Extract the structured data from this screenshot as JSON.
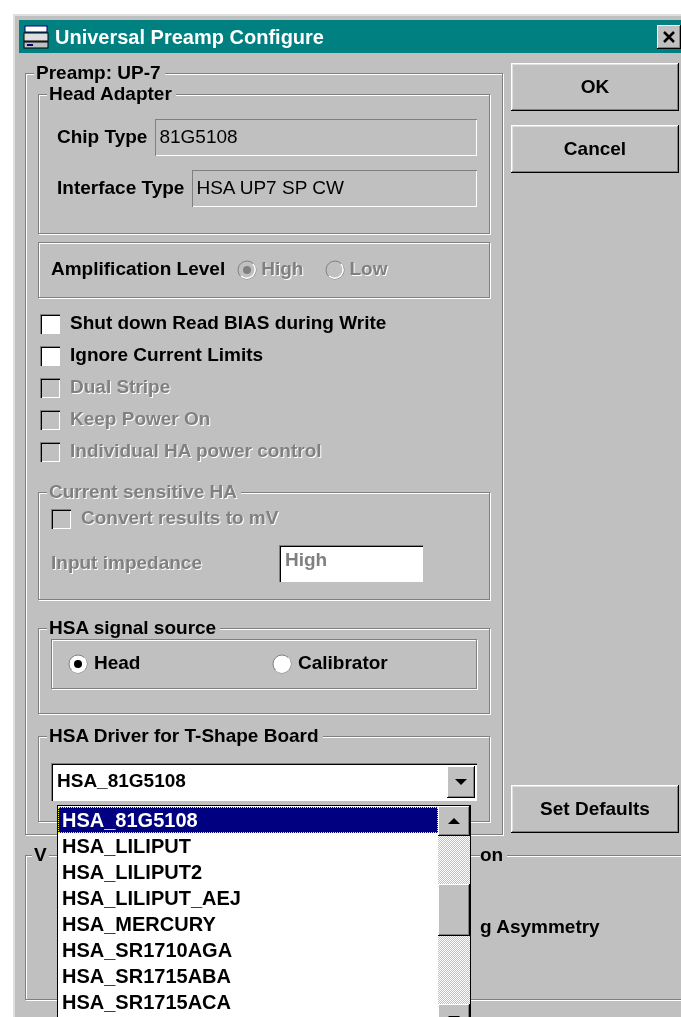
{
  "window": {
    "title": "Universal Preamp Configure"
  },
  "preamp_group": {
    "title": "Preamp: UP-7",
    "head_adapter": {
      "title": "Head Adapter",
      "fields": [
        {
          "label": "Chip Type",
          "value": "81G5108"
        },
        {
          "label": "Interface Type",
          "value": "HSA UP7 SP CW"
        }
      ]
    },
    "amplification_level": {
      "label": "Amplification Level",
      "options": [
        {
          "label": "High",
          "selected": true,
          "disabled": true
        },
        {
          "label": "Low",
          "selected": false,
          "disabled": true
        }
      ]
    },
    "checkboxes": [
      {
        "label": "Shut down Read BIAS during Write",
        "checked": false,
        "disabled": false
      },
      {
        "label": "Ignore Current Limits",
        "checked": false,
        "disabled": false
      },
      {
        "label": "Dual Stripe",
        "checked": false,
        "disabled": true
      },
      {
        "label": "Keep Power On",
        "checked": false,
        "disabled": true
      },
      {
        "label": "Individual HA power control",
        "checked": false,
        "disabled": true
      }
    ],
    "current_sensitive_ha": {
      "title": "Current sensitive HA",
      "disabled": true,
      "checkbox": {
        "label": "Convert results to mV",
        "checked": false,
        "disabled": true
      },
      "input_impedance": {
        "label": "Input impedance",
        "value": "High"
      }
    },
    "signal_source": {
      "title": "HSA signal source",
      "options": [
        {
          "label": "Head",
          "selected": true
        },
        {
          "label": "Calibrator",
          "selected": false
        }
      ]
    },
    "driver": {
      "title": "HSA Driver for T-Shape Board",
      "value": "HSA_81G5108"
    }
  },
  "buttons": [
    {
      "label": "OK"
    },
    {
      "label": "Cancel"
    },
    {
      "label": "Set Defaults"
    }
  ],
  "bottom_group": {
    "title_start": "V",
    "title_end": "on",
    "text": "g Asymmetry"
  },
  "dropdown_list": {
    "items": [
      {
        "label": "HSA_81G5108",
        "selected": true
      },
      {
        "label": "HSA_LILIPUT",
        "selected": false
      },
      {
        "label": "HSA_LILIPUT2",
        "selected": false
      },
      {
        "label": "HSA_LILIPUT_AEJ",
        "selected": false
      },
      {
        "label": "HSA_MERCURY",
        "selected": false
      },
      {
        "label": "HSA_SR1710AGA",
        "selected": false
      },
      {
        "label": "HSA_SR1715ABA",
        "selected": false
      },
      {
        "label": "HSA_SR1715ACA",
        "selected": false
      }
    ]
  }
}
